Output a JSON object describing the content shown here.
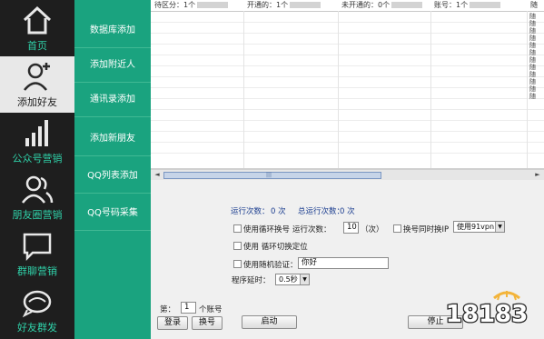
{
  "sidebar": {
    "items": [
      {
        "label": "首页",
        "icon": "home-icon",
        "active": false
      },
      {
        "label": "添加好友",
        "icon": "add-friend-icon",
        "active": true
      },
      {
        "label": "公众号营销",
        "icon": "bar-chart-icon",
        "active": false
      },
      {
        "label": "朋友圈营销",
        "icon": "people-icon",
        "active": false
      },
      {
        "label": "群聊营销",
        "icon": "chat-bubble-icon",
        "active": false
      },
      {
        "label": "好友群发",
        "icon": "broadcast-icon",
        "active": false
      }
    ]
  },
  "submenu": {
    "items": [
      {
        "label": "数据库添加"
      },
      {
        "label": "添加附近人"
      },
      {
        "label": "通讯录添加"
      },
      {
        "label": "添加新朋友"
      },
      {
        "label": "QQ列表添加"
      },
      {
        "label": "QQ号码采集"
      }
    ]
  },
  "grid": {
    "headers": [
      {
        "label": "待区分：1个"
      },
      {
        "label": "开通的：1个"
      },
      {
        "label": "未开通的：0个"
      },
      {
        "label": "账号：1个"
      },
      {
        "label": "随"
      }
    ],
    "side_cells": [
      "随",
      "随",
      "随",
      "随",
      "随",
      "随",
      "随",
      "随",
      "随",
      "随",
      "随",
      "随"
    ]
  },
  "scrollbar": {
    "left_arrow": "◄",
    "right_arrow": "►",
    "grip": "|||"
  },
  "controls": {
    "run_count_label": "运行次数：",
    "run_count_value": "0 次",
    "total_run_count_label": "总运行次数：",
    "total_run_count_value": "0 次",
    "loop_switch_label": "使用循环换号",
    "run_times_label": "运行次数：",
    "run_times_value": "10",
    "run_times_unit": "（次）",
    "switch_ip_label": "换号同时换IP",
    "vpn_select": "使用91vpn",
    "loop_location_label": "使用 循环切换定位",
    "random_verify_label": "使用随机验证：",
    "random_verify_value": "你好",
    "delay_label": "程序延时：",
    "delay_value": "0.5秒",
    "account_prefix": "第：",
    "account_index": "1",
    "account_suffix": "个账号",
    "login_button": "登录",
    "switch_account_button": "换号",
    "start_button": "启动",
    "stop_button": "停止"
  },
  "watermark": {
    "text": "18183"
  }
}
